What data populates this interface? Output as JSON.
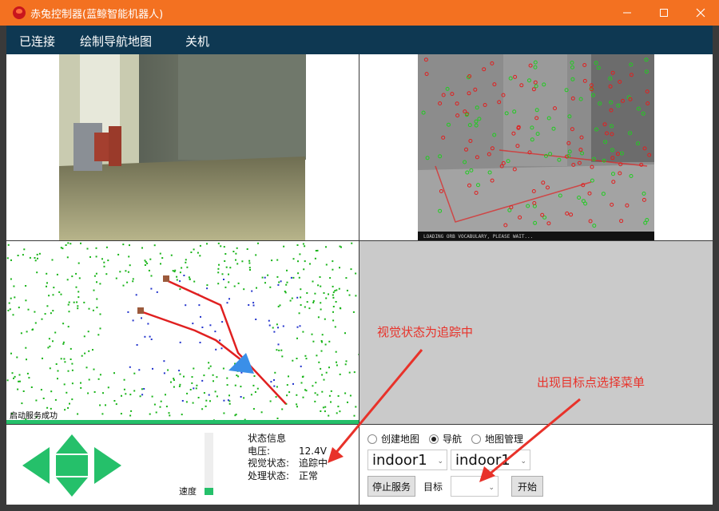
{
  "window": {
    "title": "赤兔控制器(蓝鲸智能机器人)"
  },
  "menu": {
    "items": [
      "已连接",
      "绘制导航地图",
      "关机"
    ]
  },
  "camera_right": {
    "overlay_text": "LOADING ORB VOCABULARY, PLEASE WAIT..."
  },
  "map": {
    "status_text": "启动服务成功"
  },
  "status": {
    "heading": "状态信息",
    "voltage_label": "电压:",
    "voltage_value": "12.4V",
    "vision_label": "视觉状态:",
    "vision_value": "追踪中",
    "process_label": "处理状态:",
    "process_value": "正常"
  },
  "speed": {
    "label": "速度",
    "level": 0.12
  },
  "nav": {
    "modes": [
      "创建地图",
      "导航",
      "地图管理"
    ],
    "selected_mode": "导航",
    "map_select_1": "indoor1",
    "map_select_2": "indoor1",
    "stop_label": "停止服务",
    "target_label": "目标",
    "target_value": "",
    "start_label": "开始"
  },
  "annotations": {
    "vision": "视觉状态为追踪中",
    "menu": "出现目标点选择菜单"
  },
  "colors": {
    "titlebar": "#f37121",
    "menubar": "#0e3852",
    "accent_green": "#25c06a",
    "annotation_red": "#e8322a",
    "map_dots_green": "#18b418",
    "map_dots_blue": "#2233cc",
    "path_red": "#e02020",
    "robot_blue": "#3a8fe8"
  }
}
